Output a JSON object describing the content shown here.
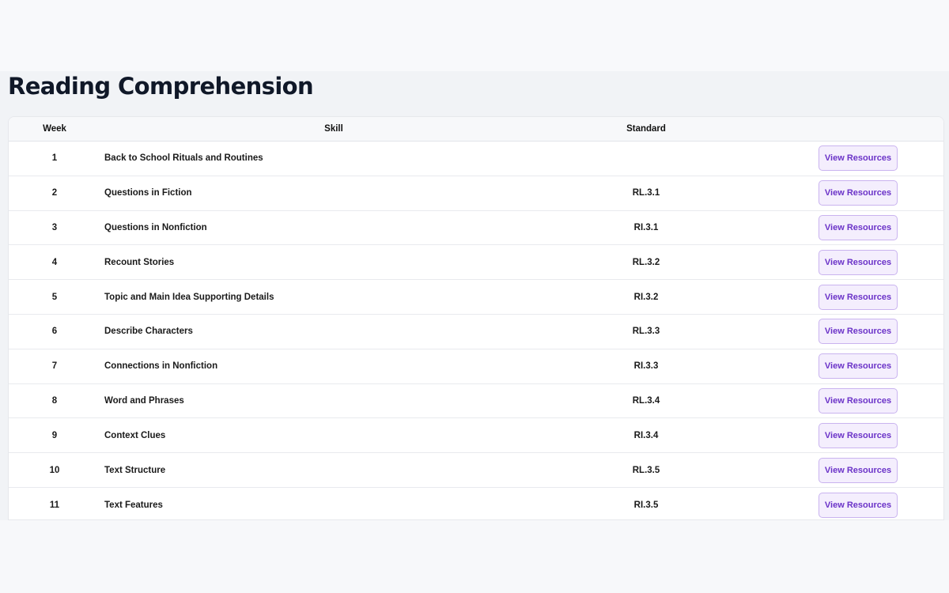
{
  "page": {
    "title": "Reading Comprehension"
  },
  "table": {
    "headers": {
      "week": "Week",
      "skill": "Skill",
      "standard": "Standard"
    },
    "button_label": "View Resources",
    "rows": [
      {
        "week": "1",
        "skill": "Back to School Rituals and Routines",
        "standard": ""
      },
      {
        "week": "2",
        "skill": "Questions in Fiction",
        "standard": "RL.3.1"
      },
      {
        "week": "3",
        "skill": "Questions in Nonfiction",
        "standard": "RI.3.1"
      },
      {
        "week": "4",
        "skill": "Recount Stories",
        "standard": "RL.3.2"
      },
      {
        "week": "5",
        "skill": "Topic and Main Idea Supporting Details",
        "standard": "RI.3.2"
      },
      {
        "week": "6",
        "skill": "Describe Characters",
        "standard": "RL.3.3"
      },
      {
        "week": "7",
        "skill": "Connections in Nonfiction",
        "standard": "RI.3.3"
      },
      {
        "week": "8",
        "skill": "Word and Phrases",
        "standard": "RL.3.4"
      },
      {
        "week": "9",
        "skill": "Context Clues",
        "standard": "RI.3.4"
      },
      {
        "week": "10",
        "skill": "Text Structure",
        "standard": "RL.3.5"
      },
      {
        "week": "11",
        "skill": "Text Features",
        "standard": "RI.3.5"
      }
    ]
  },
  "colors": {
    "button_text": "#6b33c8",
    "button_bg": "#f4eefd",
    "button_border": "#c9b3ef",
    "title": "#101828"
  }
}
